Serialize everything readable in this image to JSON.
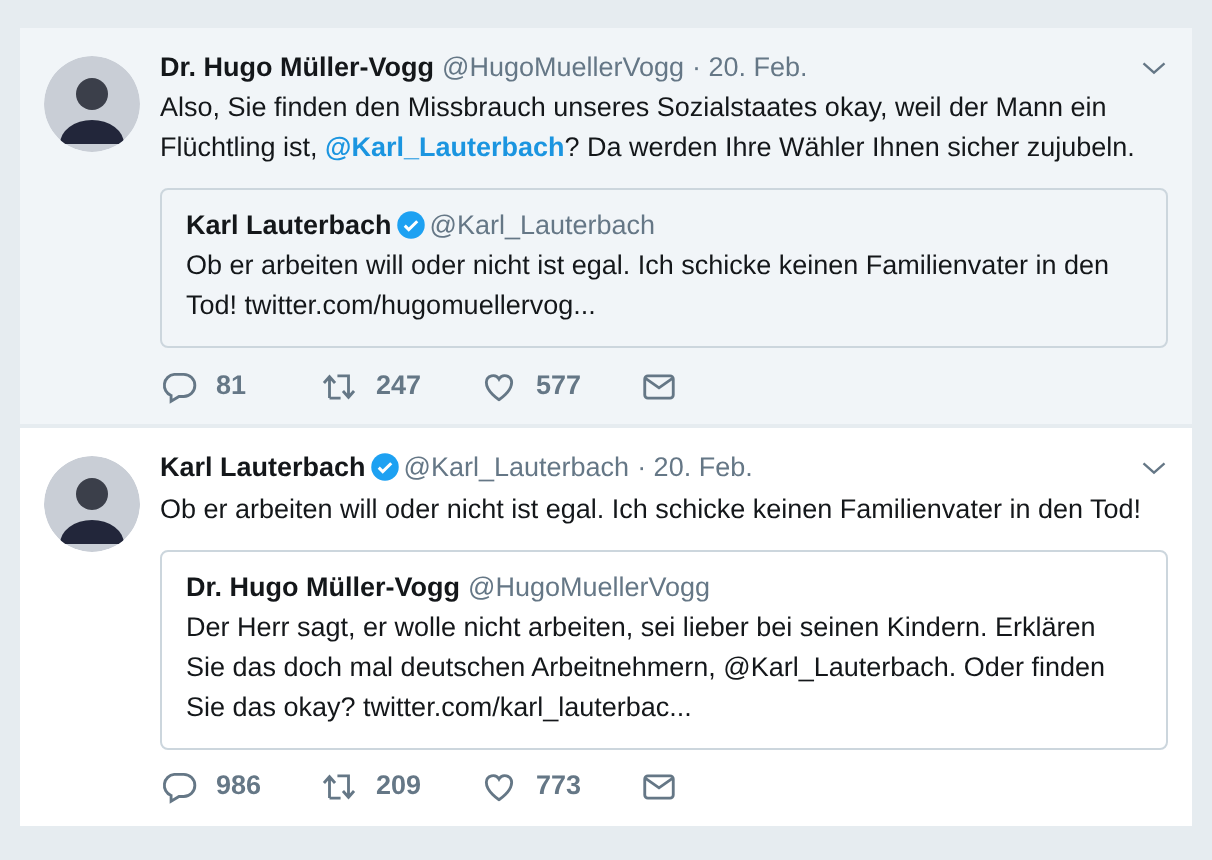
{
  "tweets": [
    {
      "name": "Dr. Hugo Müller-Vogg",
      "verified": false,
      "handle": "@HugoMuellerVogg",
      "time": "· 20. Feb.",
      "highlighted": true,
      "body": [
        {
          "kind": "text",
          "text": "Also, Sie finden den Missbrauch unseres Sozialstaates okay, weil der Mann ein Flüchtling ist, "
        },
        {
          "kind": "mention",
          "text": "@Karl_Lauterbach"
        },
        {
          "kind": "text",
          "text": "? Da werden Ihre Wähler Ihnen sicher zujubeln."
        }
      ],
      "quote": {
        "name": "Karl Lauterbach",
        "verified": true,
        "handle": "@Karl_Lauterbach",
        "text": "Ob er arbeiten will oder nicht ist egal. Ich schicke keinen Familienvater in den Tod! twitter.com/hugomuellervog..."
      },
      "replies": "81",
      "retweets": "247",
      "likes": "577"
    },
    {
      "name": "Karl Lauterbach",
      "verified": true,
      "handle": "@Karl_Lauterbach",
      "time": "· 20. Feb.",
      "highlighted": false,
      "body": [
        {
          "kind": "text",
          "text": "Ob er arbeiten will oder nicht ist egal. Ich schicke keinen Familienvater in den Tod!"
        }
      ],
      "quote": {
        "name": "Dr. Hugo Müller-Vogg",
        "verified": false,
        "handle": "@HugoMuellerVogg",
        "text": "Der Herr sagt, er wolle nicht arbeiten, sei lieber bei seinen Kindern. Erklären Sie das doch mal deutschen Arbeitnehmern, @Karl_Lauterbach. Oder finden Sie das okay? twitter.com/karl_lauterbac..."
      },
      "replies": "986",
      "retweets": "209",
      "likes": "773"
    }
  ]
}
